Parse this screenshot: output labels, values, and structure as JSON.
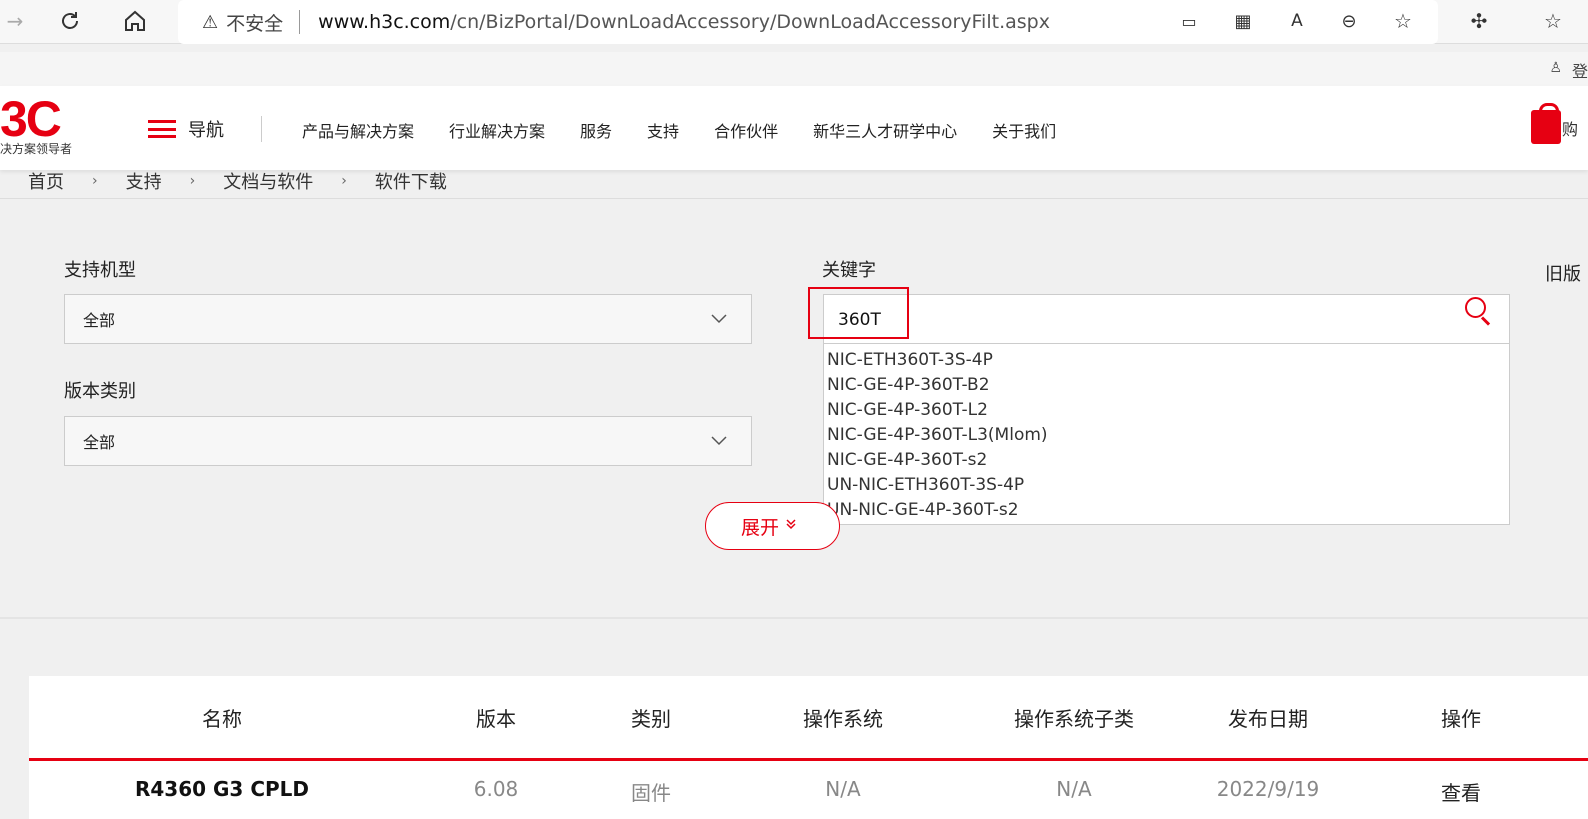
{
  "browser": {
    "address": {
      "warning_text": "不安全",
      "host": "www.h3c.com",
      "path": "/cn/BizPortal/DownLoadAccessory/DownLoadAccessoryFilt.aspx"
    }
  },
  "util_bar": {
    "partial_text": "登"
  },
  "header": {
    "logo": "3C",
    "slogan": "决方案领导者",
    "nav_menu_label": "导航",
    "nav_items": [
      "产品与解决方案",
      "行业解决方案",
      "服务",
      "支持",
      "合作伙伴",
      "新华三人才研学中心",
      "关于我们"
    ],
    "cart_partial": "购"
  },
  "breadcrumb": {
    "items": [
      "首页",
      "支持",
      "文档与软件",
      "软件下载"
    ],
    "separator": "›"
  },
  "filters": {
    "model_label": "支持机型",
    "model_value": "全部",
    "version_type_label": "版本类别",
    "version_type_value": "全部",
    "keyword_label": "关键字",
    "keyword_value": "360T",
    "right_label_partial": "旧版",
    "expand_label": "展开",
    "suggestions": [
      "NIC-ETH360T-3S-4P",
      "NIC-GE-4P-360T-B2",
      "NIC-GE-4P-360T-L2",
      "NIC-GE-4P-360T-L3(Mlom)",
      "NIC-GE-4P-360T-s2",
      "UN-NIC-ETH360T-3S-4P",
      "UN-NIC-GE-4P-360T-s2"
    ]
  },
  "table": {
    "headers": [
      "名称",
      "版本",
      "类别",
      "操作系统",
      "操作系统子类",
      "发布日期",
      "操作"
    ],
    "rows": [
      [
        "R4360 G3 CPLD",
        "6.08",
        "固件",
        "N/A",
        "N/A",
        "2022/9/19",
        "查看"
      ]
    ]
  },
  "colors": {
    "accent": "#e60012"
  }
}
